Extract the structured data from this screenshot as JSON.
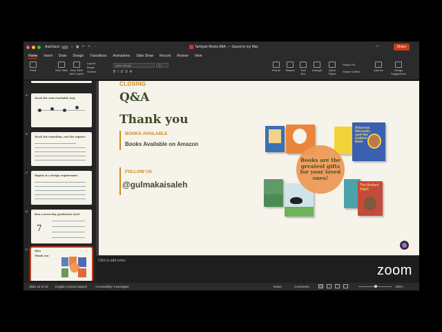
{
  "titlebar": {
    "autosave_label": "AutoSave",
    "doc_title": "Tarbiyah Meets ABA",
    "save_status": "— Saved to my Mac",
    "share_label": "Share"
  },
  "tabs": [
    "Home",
    "Insert",
    "Draw",
    "Design",
    "Transitions",
    "Animations",
    "Slide Show",
    "Record",
    "Review",
    "View"
  ],
  "ribbon": {
    "paste": "Paste",
    "new_slide": "New Slide",
    "new_slide_copilot": "New Slide with Copilot",
    "layout": "Layout",
    "reset": "Reset",
    "section": "Section",
    "font": "Aptos (Body)",
    "font_size": "12",
    "picture": "Picture",
    "shapes": "Shapes",
    "text_box": "Text Box",
    "arrange": "Arrange",
    "quick_styles": "Quick Styles",
    "shape_fill": "Shape Fill",
    "shape_outline": "Shape Outline",
    "addins": "Add-ins",
    "design_suggestions": "Design Suggestions",
    "end": "END"
  },
  "thumbnails": [
    {
      "num": "15",
      "title": "Teach the next reachable step"
    },
    {
      "num": "16",
      "title": "Teach the transition—not the rupture"
    },
    {
      "num": "17",
      "title": "Dignity is a design requirement"
    },
    {
      "num": "18",
      "title": "Run a seven-day gentleness reset",
      "big": "7"
    },
    {
      "num": "19",
      "title": "Q&A",
      "sub": "Thank you"
    }
  ],
  "slide": {
    "closing": "CLOSING",
    "qa": "Q&A",
    "thanks": "Thank you",
    "books_label": "BOOKS AVAILABLE",
    "books_text": "Books Available on Amazon",
    "follow_label": "FOLLOW US",
    "handle": "@gulmakaisaleh",
    "circle_text": "Books are the greatest gifts for your loved ones!",
    "book_titles": {
      "princess": "Princess Diversity and the Golden Rule",
      "broken": "The Broken Night"
    }
  },
  "notes_placeholder": "Click to add notes",
  "status": {
    "slide_count": "Slide 19 of 19",
    "language": "English (United States)",
    "accessibility": "Accessibility: Investigate",
    "notes": "Notes",
    "comments": "Comments",
    "zoom": "100%"
  },
  "zoom_logo": "zoom",
  "colors": {
    "accent": "#c43e1c",
    "slide_bg": "#f6f3ea",
    "olive": "#3d4a2a",
    "gold": "#c98a1e",
    "circle": "#ee9b5a"
  }
}
